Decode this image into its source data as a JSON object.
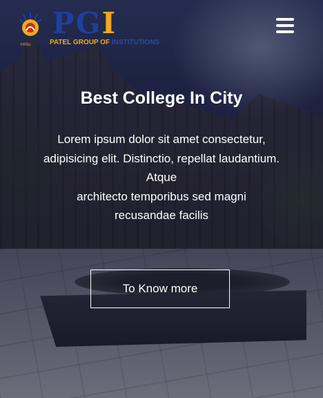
{
  "header": {
    "logo": {
      "letters": [
        "P",
        "G",
        "I"
      ],
      "subtitle": "PATEL GROUP OF",
      "subtitle_rest": "INSTITUTIONS",
      "emblem_text": "PATEL"
    },
    "menu_icon": "hamburger-menu-icon"
  },
  "hero": {
    "title": "Best College In City",
    "description_lines": [
      "Lorem ipsum dolor sit amet consectetur,",
      "adipisicing elit. Distinctio, repellat laudantium.",
      "Atque",
      "architecto temporibus sed magni",
      "recusandae facilis"
    ],
    "cta_label": "To Know more"
  },
  "colors": {
    "logo_blue": "#1f3fa0",
    "logo_orange": "#f2a91a",
    "text": "#ffffff"
  }
}
